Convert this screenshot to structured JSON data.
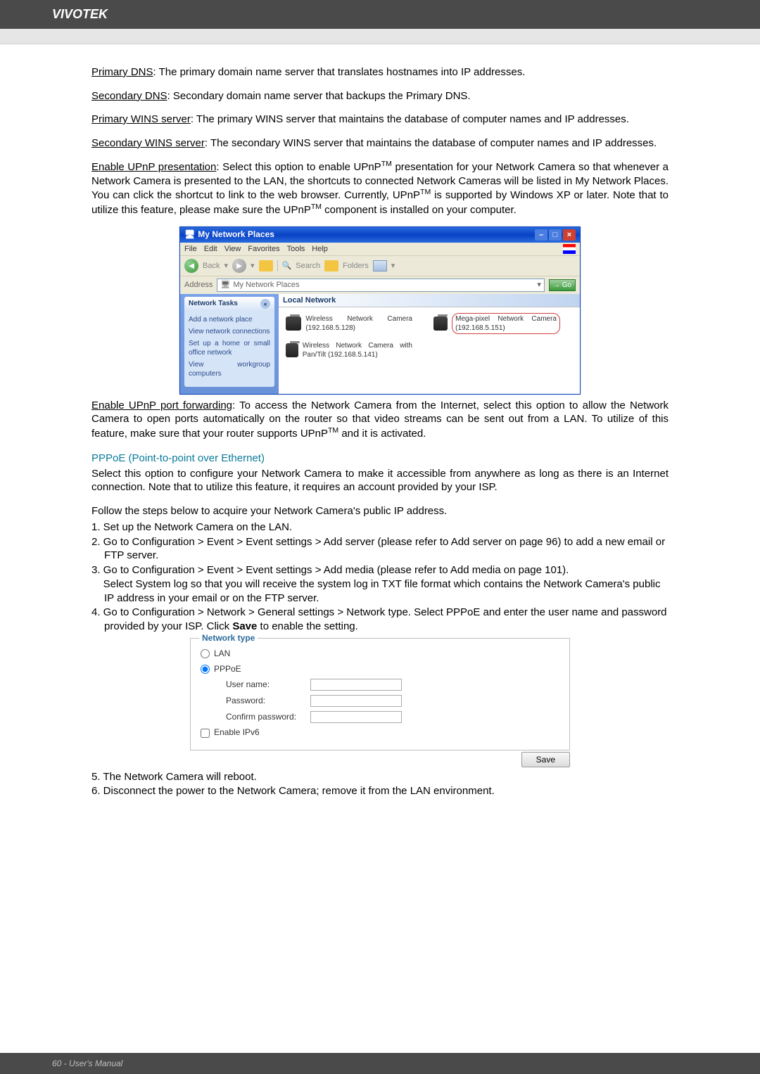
{
  "header": {
    "brand": "VIVOTEK"
  },
  "defs": {
    "primary_dns": {
      "label": "Primary DNS",
      "text": ": The primary domain name server that translates hostnames into IP addresses."
    },
    "secondary_dns": {
      "label": "Secondary DNS",
      "text": ": Secondary domain name server that backups the Primary DNS."
    },
    "primary_wins": {
      "label": "Primary WINS server",
      "text": ": The primary WINS server that maintains the database of computer names and IP addresses."
    },
    "secondary_wins": {
      "label": "Secondary WINS server",
      "text": ": The secondary WINS server that maintains the database of computer names and IP addresses."
    },
    "upnp_pres": {
      "label": "Enable UPnP presentation",
      "text_a": ": Select this option to enable UPnP",
      "tm": "TM",
      "text_b": " presentation for your Network Camera so that whenever a Network Camera is presented to the LAN, the shortcuts to connected Network Cameras will be listed in My Network Places. You can click the shortcut to link to the web browser. Currently, UPnP",
      "text_c": " is supported by Windows XP or later. Note that to utilize this feature, please make sure the UPnP",
      "text_d": " component is installed on your computer."
    },
    "upnp_fwd": {
      "label": "Enable UPnP port forwarding",
      "text_a": ": To access the Network Camera from the Internet, select this option to allow the Network Camera to open ports automatically on the router so that video streams can be sent out from a LAN. To utilize of this feature, make sure that your router supports UPnP",
      "tm": "TM",
      "text_b": " and it is activated."
    }
  },
  "xp": {
    "title": "My Network Places",
    "menu": [
      "File",
      "Edit",
      "View",
      "Favorites",
      "Tools",
      "Help"
    ],
    "toolbar": {
      "back": "Back",
      "search": "Search",
      "folders": "Folders"
    },
    "address": {
      "label": "Address",
      "value": "My Network Places",
      "go": "Go"
    },
    "tasks": {
      "header": "Network Tasks",
      "items": [
        "Add a network place",
        "View network connections",
        "Set up a home or small office network",
        "View workgroup computers"
      ]
    },
    "local": {
      "header": "Local Network"
    },
    "items": [
      {
        "name": "Wireless Network Camera (192.168.5.128)"
      },
      {
        "name": "Mega-pixel Network Camera (192.168.5.151)"
      },
      {
        "name": "Wireless Network Camera with Pan/Tilt (192.168.5.141)"
      }
    ]
  },
  "pppoe": {
    "heading": "PPPoE (Point-to-point over Ethernet)",
    "intro": "Select this option to configure your Network Camera to make it accessible from anywhere as long as there is an Internet connection. Note that to utilize this feature, it requires an account provided by your ISP.",
    "steps_intro": "Follow the steps below to acquire your Network Camera's public IP address.",
    "steps": [
      "1. Set up the Network Camera on the LAN.",
      "2. Go to Configuration > Event > Event settings > Add server (please refer to Add server on page 96) to add a new email or FTP server.",
      "3. Go to Configuration > Event > Event settings > Add media (please refer to Add media on page 101).",
      "    Select System log so that you will receive the system log in TXT file format which contains the Network Camera's public IP address in your email or on the FTP server."
    ],
    "step4_a": "4. Go to Configuration > Network > General settings > Network type. Select PPPoE and enter the user name and password provided by your ISP. Click ",
    "step4_bold": "Save",
    "step4_b": " to enable the setting."
  },
  "net_type": {
    "legend": "Network type",
    "lan": "LAN",
    "pppoe": "PPPoE",
    "user": "User name:",
    "pass": "Password:",
    "confirm": "Confirm password:",
    "ipv6": "Enable IPv6",
    "save": "Save"
  },
  "post_steps": [
    "5. The Network Camera will reboot.",
    "6. Disconnect the power to the Network Camera; remove it from the LAN environment."
  ],
  "footer": {
    "text": "60 - User's Manual"
  }
}
